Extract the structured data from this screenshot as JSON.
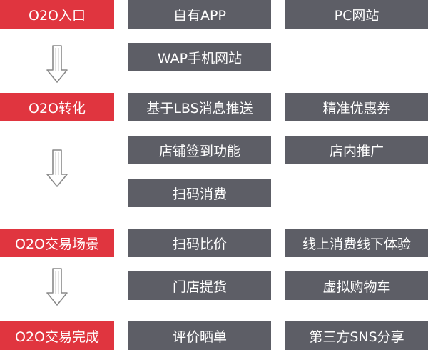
{
  "colors": {
    "stage": "#e0353f",
    "item": "#5d5e66",
    "text": "#ffffff",
    "arrow": "#8a8a8a"
  },
  "stages": [
    {
      "label": "O2O入口",
      "items": [
        "自有APP",
        "PC网站",
        "WAP手机网站"
      ]
    },
    {
      "label": "O2O转化",
      "items": [
        "基于LBS消息推送",
        "精准优惠券",
        "店铺签到功能",
        "店内推广",
        "扫码消费"
      ]
    },
    {
      "label": "O2O交易场景",
      "items": [
        "扫码比价",
        "线上消费线下体验",
        "门店提货",
        "虚拟购物车"
      ]
    },
    {
      "label": "O2O交易完成",
      "items": [
        "评价晒单",
        "第三方SNS分享"
      ]
    }
  ]
}
